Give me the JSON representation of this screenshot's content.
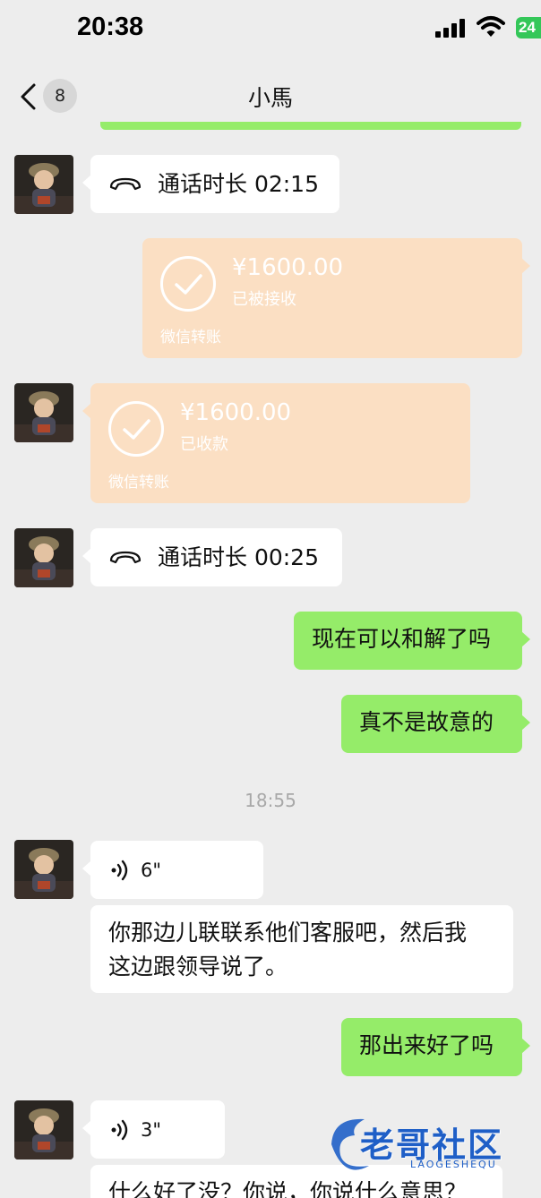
{
  "status_bar": {
    "time": "20:38",
    "battery": "24"
  },
  "nav": {
    "back_badge": "8",
    "title": "小馬"
  },
  "messages": {
    "call1": {
      "text": "通话时长 02:15"
    },
    "transfer_out": {
      "amount": "¥1600.00",
      "status": "已被接收",
      "footer": "微信转账"
    },
    "transfer_in": {
      "amount": "¥1600.00",
      "status": "已收款",
      "footer": "微信转账"
    },
    "call2": {
      "text": "通话时长 00:25"
    },
    "sent1": {
      "text": "现在可以和解了吗"
    },
    "sent2": {
      "text": "真不是故意的"
    },
    "timestamp": "18:55",
    "voice1": {
      "duration": "6\""
    },
    "recv_text": {
      "line1": "你那边儿联联系他们客服吧，然后我",
      "line2": "这边跟领导说了。"
    },
    "sent3": {
      "text": "那出来好了吗"
    },
    "voice2": {
      "duration": "3\""
    },
    "recv_cut": {
      "text": "什么好了没？你说，你说什么意思？"
    }
  },
  "watermark": {
    "text": "老哥社区",
    "sub": "LAOGESHEQU"
  },
  "icons": {
    "back": "chevron-left-icon",
    "call": "phone-hangup-icon",
    "check": "check-circle-icon",
    "voice": "voice-wave-icon"
  },
  "colors": {
    "background": "#ededed",
    "sent_bubble": "#95ec69",
    "received_bubble": "#ffffff",
    "transfer_bubble": "#fbdfc3",
    "timestamp": "#a8a8a8"
  }
}
